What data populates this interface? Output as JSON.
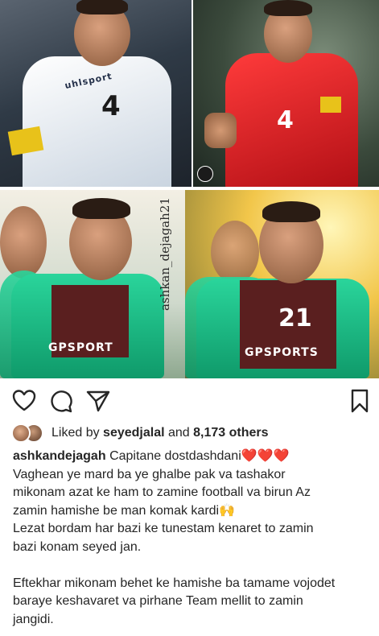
{
  "post": {
    "photo_watermark": "ashkan_dejagah21",
    "photos": [
      {
        "jersey_number": "4",
        "kit_brand": "uhlsport"
      },
      {
        "jersey_number": "4"
      },
      {
        "bib_text": "GPSPORT"
      },
      {
        "bib_text": "GPSPORTS",
        "bib_number": "21"
      }
    ]
  },
  "actions": {
    "like": "heart-icon",
    "comment": "comment-icon",
    "share": "send-icon",
    "save": "bookmark-icon"
  },
  "likes": {
    "prefix": "Liked by ",
    "user": "seyedjalal",
    "conjunction": " and ",
    "count": "8,173 others"
  },
  "caption": {
    "username": "ashkandejagah",
    "first_line": "Capitane dostdashdani❤️❤️❤️",
    "lines": [
      "Vaghean ye mard ba ye ghalbe pak va tashakor",
      "mikonam azat ke ham to zamine football va birun Az",
      "zamin hamishe be man komak kardi🙌",
      "Lezat bordam har bazi ke tunestam kenaret to zamin",
      "bazi konam seyed jan."
    ],
    "lines2": [
      "Eftekhar mikonam behet ke hamishe ba tamame vojodet",
      "baraye keshavaret va pirhane Team mellit to zamin",
      "jangidi."
    ]
  },
  "colors": {
    "text": "#262626",
    "background": "#ffffff",
    "heart": "#e0245e"
  }
}
